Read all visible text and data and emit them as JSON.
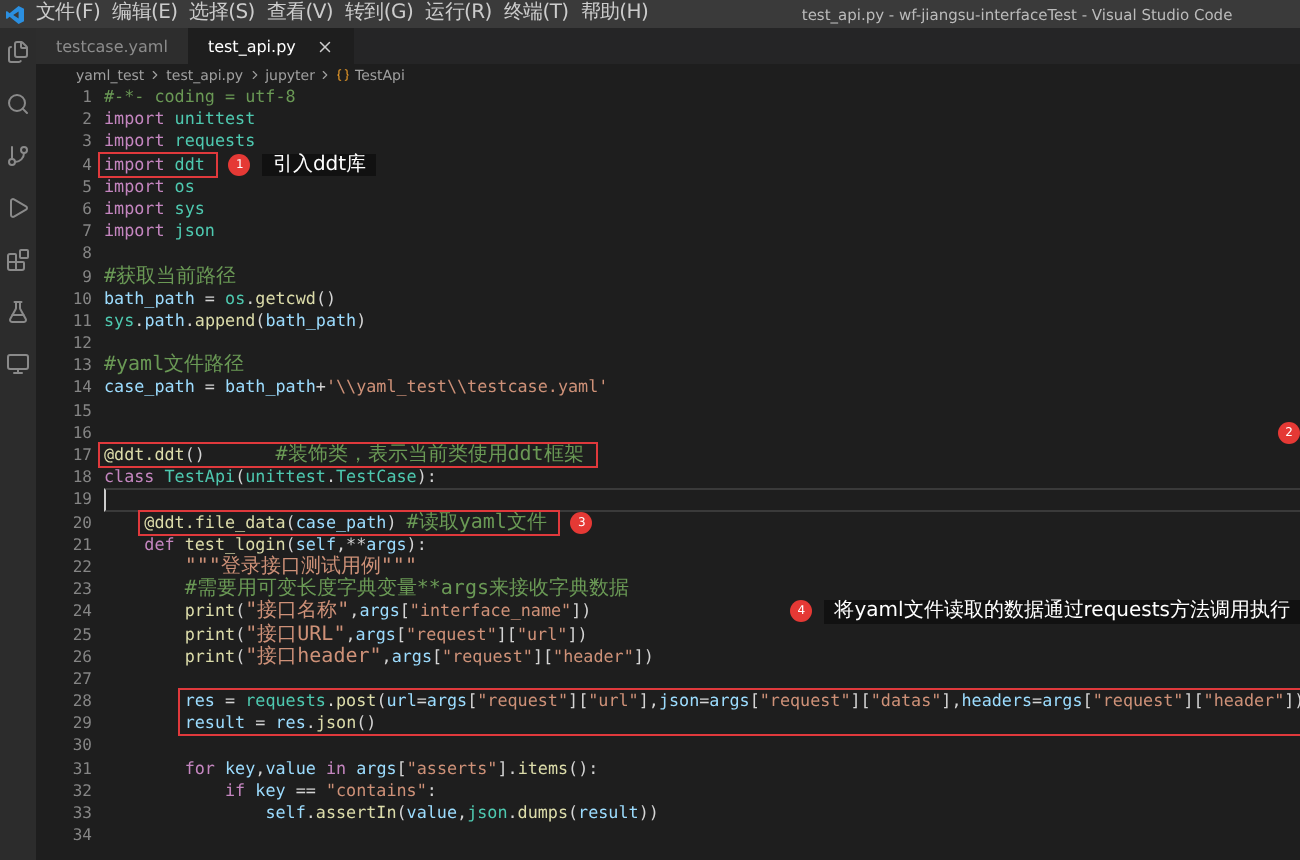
{
  "window": {
    "menu": [
      "文件(F)",
      "编辑(E)",
      "选择(S)",
      "查看(V)",
      "转到(G)",
      "运行(R)",
      "终端(T)",
      "帮助(H)"
    ],
    "title": "test_api.py - wf-jiangsu-interfaceTest - Visual Studio Code"
  },
  "tabs": [
    {
      "label": "testcase.yaml",
      "selected": false
    },
    {
      "label": "test_api.py",
      "selected": true
    }
  ],
  "breadcrumb": [
    "yaml_test",
    "test_api.py",
    "jupyter",
    "TestApi"
  ],
  "code": {
    "blocks": [
      {
        "boxed": false,
        "lines": [
          {
            "number": "1",
            "active": false,
            "tokens": [
              {
                "kind": "comment",
                "text": "#-*- coding = utf-8"
              }
            ]
          },
          {
            "number": "2",
            "active": false,
            "tokens": [
              {
                "kind": "keyword",
                "text": "import "
              },
              {
                "kind": "module",
                "text": "unittest"
              }
            ]
          },
          {
            "number": "3",
            "active": false,
            "tokens": [
              {
                "kind": "keyword",
                "text": "import "
              },
              {
                "kind": "module",
                "text": "requests"
              }
            ]
          }
        ]
      },
      {
        "boxed": true,
        "note": {
          "kind": "attached",
          "badge": "1",
          "label": "引入ddt库"
        },
        "lines": [
          {
            "number": "4",
            "active": false,
            "tokens": [
              {
                "kind": "keyword",
                "text": "import "
              },
              {
                "kind": "module",
                "text": "ddt"
              }
            ]
          }
        ]
      },
      {
        "boxed": false,
        "lines": [
          {
            "number": "5",
            "active": false,
            "tokens": [
              {
                "kind": "keyword",
                "text": "import "
              },
              {
                "kind": "module",
                "text": "os"
              }
            ]
          },
          {
            "number": "6",
            "active": false,
            "tokens": [
              {
                "kind": "keyword",
                "text": "import "
              },
              {
                "kind": "module",
                "text": "sys"
              }
            ]
          },
          {
            "number": "7",
            "active": false,
            "tokens": [
              {
                "kind": "keyword",
                "text": "import "
              },
              {
                "kind": "module",
                "text": "json"
              }
            ]
          },
          {
            "number": "8",
            "active": false
          },
          {
            "number": "9",
            "active": false,
            "tokens": [
              {
                "kind": "comment",
                "text": "#获取当前路径"
              }
            ]
          },
          {
            "number": "10",
            "active": false,
            "tokens": [
              {
                "kind": "variable",
                "text": "bath_path"
              },
              {
                "kind": "plain",
                "text": " = "
              },
              {
                "kind": "module",
                "text": "os"
              },
              {
                "kind": "plain",
                "text": "."
              },
              {
                "kind": "function",
                "text": "getcwd"
              },
              {
                "kind": "plain",
                "text": "()"
              }
            ]
          },
          {
            "number": "11",
            "active": false,
            "tokens": [
              {
                "kind": "module",
                "text": "sys"
              },
              {
                "kind": "plain",
                "text": "."
              },
              {
                "kind": "variable",
                "text": "path"
              },
              {
                "kind": "plain",
                "text": "."
              },
              {
                "kind": "function",
                "text": "append"
              },
              {
                "kind": "plain",
                "text": "("
              },
              {
                "kind": "variable",
                "text": "bath_path"
              },
              {
                "kind": "plain",
                "text": ")"
              }
            ]
          },
          {
            "number": "12",
            "active": false
          },
          {
            "number": "13",
            "active": false,
            "tokens": [
              {
                "kind": "comment",
                "text": "#yaml文件路径"
              }
            ]
          },
          {
            "number": "14",
            "active": false,
            "tokens": [
              {
                "kind": "variable",
                "text": "case_path"
              },
              {
                "kind": "plain",
                "text": " = "
              },
              {
                "kind": "variable",
                "text": "bath_path"
              },
              {
                "kind": "plain",
                "text": "+"
              },
              {
                "kind": "string",
                "text": "'\\\\yaml_test\\\\testcase.yaml'"
              }
            ]
          },
          {
            "number": "15",
            "active": false
          }
        ]
      },
      {
        "boxed": false,
        "note": {
          "kind": "floating",
          "badge": "2"
        },
        "lines": [
          {
            "number": "16",
            "active": false
          }
        ]
      },
      {
        "boxed": true,
        "lines": [
          {
            "number": "17",
            "active": false,
            "tokens": [
              {
                "kind": "function",
                "text": "@ddt.ddt"
              },
              {
                "kind": "plain",
                "text": "()       "
              },
              {
                "kind": "comment",
                "text": "#装饰类，表示当前类使用ddt框架"
              }
            ]
          }
        ]
      },
      {
        "boxed": false,
        "lines": [
          {
            "number": "18",
            "active": false,
            "tokens": [
              {
                "kind": "keyword",
                "text": "class "
              },
              {
                "kind": "module",
                "text": "TestApi"
              },
              {
                "kind": "plain",
                "text": "("
              },
              {
                "kind": "module",
                "text": "unittest"
              },
              {
                "kind": "plain",
                "text": "."
              },
              {
                "kind": "module",
                "text": "TestCase"
              },
              {
                "kind": "plain",
                "text": "):"
              }
            ]
          },
          {
            "number": "19",
            "active": true
          }
        ]
      },
      {
        "kind": "class_member",
        "boxed": true,
        "note": {
          "kind": "attached",
          "badge": "3"
        },
        "lines": [
          {
            "number": "20",
            "active": false,
            "tokens": [
              {
                "kind": "function",
                "text": "@ddt.file_data"
              },
              {
                "kind": "plain",
                "text": "("
              },
              {
                "kind": "variable",
                "text": "case_path"
              },
              {
                "kind": "plain",
                "text": ") "
              },
              {
                "kind": "comment",
                "text": "#读取yaml文件"
              }
            ]
          }
        ]
      },
      {
        "kind": "class_member",
        "boxed": false,
        "lines": [
          {
            "number": "21",
            "active": false,
            "tokens": [
              {
                "kind": "keyword",
                "text": "def "
              },
              {
                "kind": "function",
                "text": "test_login"
              },
              {
                "kind": "plain",
                "text": "("
              },
              {
                "kind": "variable",
                "text": "self"
              },
              {
                "kind": "plain",
                "text": ",**"
              },
              {
                "kind": "variable",
                "text": "args"
              },
              {
                "kind": "plain",
                "text": "):"
              }
            ]
          }
        ]
      },
      {
        "kind": "method_body",
        "boxed": false,
        "lines": [
          {
            "number": "22",
            "active": false,
            "tokens": [
              {
                "kind": "string",
                "text": "\"\"\"登录接口测试用例\"\"\""
              }
            ]
          },
          {
            "number": "23",
            "active": false,
            "tokens": [
              {
                "kind": "comment",
                "text": "#需要用可变长度字典变量**args来接收字典数据"
              }
            ]
          }
        ]
      },
      {
        "kind": "method_body",
        "boxed": false,
        "note": {
          "kind": "floating",
          "badge": "4",
          "label": "将yaml文件读取的数据通过requests方法调用执行"
        },
        "lines": [
          {
            "number": "24",
            "active": false,
            "tokens": [
              {
                "kind": "function",
                "text": "print"
              },
              {
                "kind": "plain",
                "text": "("
              },
              {
                "kind": "string",
                "text": "\"接口名称\""
              },
              {
                "kind": "plain",
                "text": ","
              },
              {
                "kind": "variable",
                "text": "args"
              },
              {
                "kind": "plain",
                "text": "["
              },
              {
                "kind": "string",
                "text": "\"interface_name\""
              },
              {
                "kind": "plain",
                "text": "])"
              }
            ]
          }
        ]
      },
      {
        "kind": "method_body",
        "boxed": false,
        "lines": [
          {
            "number": "25",
            "active": false,
            "tokens": [
              {
                "kind": "function",
                "text": "print"
              },
              {
                "kind": "plain",
                "text": "("
              },
              {
                "kind": "string",
                "text": "\"接口URL\""
              },
              {
                "kind": "plain",
                "text": ","
              },
              {
                "kind": "variable",
                "text": "args"
              },
              {
                "kind": "plain",
                "text": "["
              },
              {
                "kind": "string",
                "text": "\"request\""
              },
              {
                "kind": "plain",
                "text": "]["
              },
              {
                "kind": "string",
                "text": "\"url\""
              },
              {
                "kind": "plain",
                "text": "])"
              }
            ]
          },
          {
            "number": "26",
            "active": false,
            "tokens": [
              {
                "kind": "function",
                "text": "print"
              },
              {
                "kind": "plain",
                "text": "("
              },
              {
                "kind": "string",
                "text": "\"接口header\""
              },
              {
                "kind": "plain",
                "text": ","
              },
              {
                "kind": "variable",
                "text": "args"
              },
              {
                "kind": "plain",
                "text": "["
              },
              {
                "kind": "string",
                "text": "\"request\""
              },
              {
                "kind": "plain",
                "text": "]["
              },
              {
                "kind": "string",
                "text": "\"header\""
              },
              {
                "kind": "plain",
                "text": "])"
              }
            ]
          },
          {
            "number": "27",
            "active": false
          }
        ]
      },
      {
        "kind": "method_body",
        "boxed": true,
        "lines": [
          {
            "number": "28",
            "active": false,
            "tokens": [
              {
                "kind": "variable",
                "text": "res"
              },
              {
                "kind": "plain",
                "text": " = "
              },
              {
                "kind": "module",
                "text": "requests"
              },
              {
                "kind": "plain",
                "text": "."
              },
              {
                "kind": "function",
                "text": "post"
              },
              {
                "kind": "plain",
                "text": "("
              },
              {
                "kind": "variable",
                "text": "url"
              },
              {
                "kind": "plain",
                "text": "="
              },
              {
                "kind": "variable",
                "text": "args"
              },
              {
                "kind": "plain",
                "text": "["
              },
              {
                "kind": "string",
                "text": "\"request\""
              },
              {
                "kind": "plain",
                "text": "]["
              },
              {
                "kind": "string",
                "text": "\"url\""
              },
              {
                "kind": "plain",
                "text": "],"
              },
              {
                "kind": "variable",
                "text": "json"
              },
              {
                "kind": "plain",
                "text": "="
              },
              {
                "kind": "variable",
                "text": "args"
              },
              {
                "kind": "plain",
                "text": "["
              },
              {
                "kind": "string",
                "text": "\"request\""
              },
              {
                "kind": "plain",
                "text": "]["
              },
              {
                "kind": "string",
                "text": "\"datas\""
              },
              {
                "kind": "plain",
                "text": "],"
              },
              {
                "kind": "variable",
                "text": "headers"
              },
              {
                "kind": "plain",
                "text": "="
              },
              {
                "kind": "variable",
                "text": "args"
              },
              {
                "kind": "plain",
                "text": "["
              },
              {
                "kind": "string",
                "text": "\"request\""
              },
              {
                "kind": "plain",
                "text": "]["
              },
              {
                "kind": "string",
                "text": "\"header\""
              },
              {
                "kind": "plain",
                "text": "])"
              }
            ]
          },
          {
            "number": "29",
            "active": false,
            "tokens": [
              {
                "kind": "variable",
                "text": "result"
              },
              {
                "kind": "plain",
                "text": " = "
              },
              {
                "kind": "variable",
                "text": "res"
              },
              {
                "kind": "plain",
                "text": "."
              },
              {
                "kind": "function",
                "text": "json"
              },
              {
                "kind": "plain",
                "text": "()"
              }
            ]
          }
        ]
      },
      {
        "boxed": false,
        "lines": [
          {
            "number": "30",
            "active": false
          }
        ]
      },
      {
        "kind": "method_body",
        "boxed": false,
        "lines": [
          {
            "number": "31",
            "active": false,
            "tokens": [
              {
                "kind": "keyword",
                "text": "for "
              },
              {
                "kind": "variable",
                "text": "key"
              },
              {
                "kind": "plain",
                "text": ","
              },
              {
                "kind": "variable",
                "text": "value "
              },
              {
                "kind": "keyword",
                "text": "in "
              },
              {
                "kind": "variable",
                "text": "args"
              },
              {
                "kind": "plain",
                "text": "["
              },
              {
                "kind": "string",
                "text": "\"asserts\""
              },
              {
                "kind": "plain",
                "text": "]."
              },
              {
                "kind": "function",
                "text": "items"
              },
              {
                "kind": "plain",
                "text": "():"
              }
            ]
          }
        ]
      },
      {
        "kind": "loop_body",
        "boxed": false,
        "lines": [
          {
            "number": "32",
            "active": false,
            "tokens": [
              {
                "kind": "keyword",
                "text": "if "
              },
              {
                "kind": "variable",
                "text": "key"
              },
              {
                "kind": "plain",
                "text": " == "
              },
              {
                "kind": "string",
                "text": "\"contains\""
              },
              {
                "kind": "plain",
                "text": ":"
              }
            ]
          }
        ]
      },
      {
        "kind": "branch_body",
        "boxed": false,
        "lines": [
          {
            "number": "33",
            "active": false,
            "tokens": [
              {
                "kind": "variable",
                "text": "self"
              },
              {
                "kind": "plain",
                "text": "."
              },
              {
                "kind": "function",
                "text": "assertIn"
              },
              {
                "kind": "plain",
                "text": "("
              },
              {
                "kind": "variable",
                "text": "value"
              },
              {
                "kind": "plain",
                "text": ","
              },
              {
                "kind": "module",
                "text": "json"
              },
              {
                "kind": "plain",
                "text": "."
              },
              {
                "kind": "function",
                "text": "dumps"
              },
              {
                "kind": "plain",
                "text": "("
              },
              {
                "kind": "variable",
                "text": "result"
              },
              {
                "kind": "plain",
                "text": "))"
              }
            ]
          }
        ]
      },
      {
        "boxed": false,
        "lines": [
          {
            "number": "34",
            "active": false
          }
        ]
      }
    ]
  }
}
